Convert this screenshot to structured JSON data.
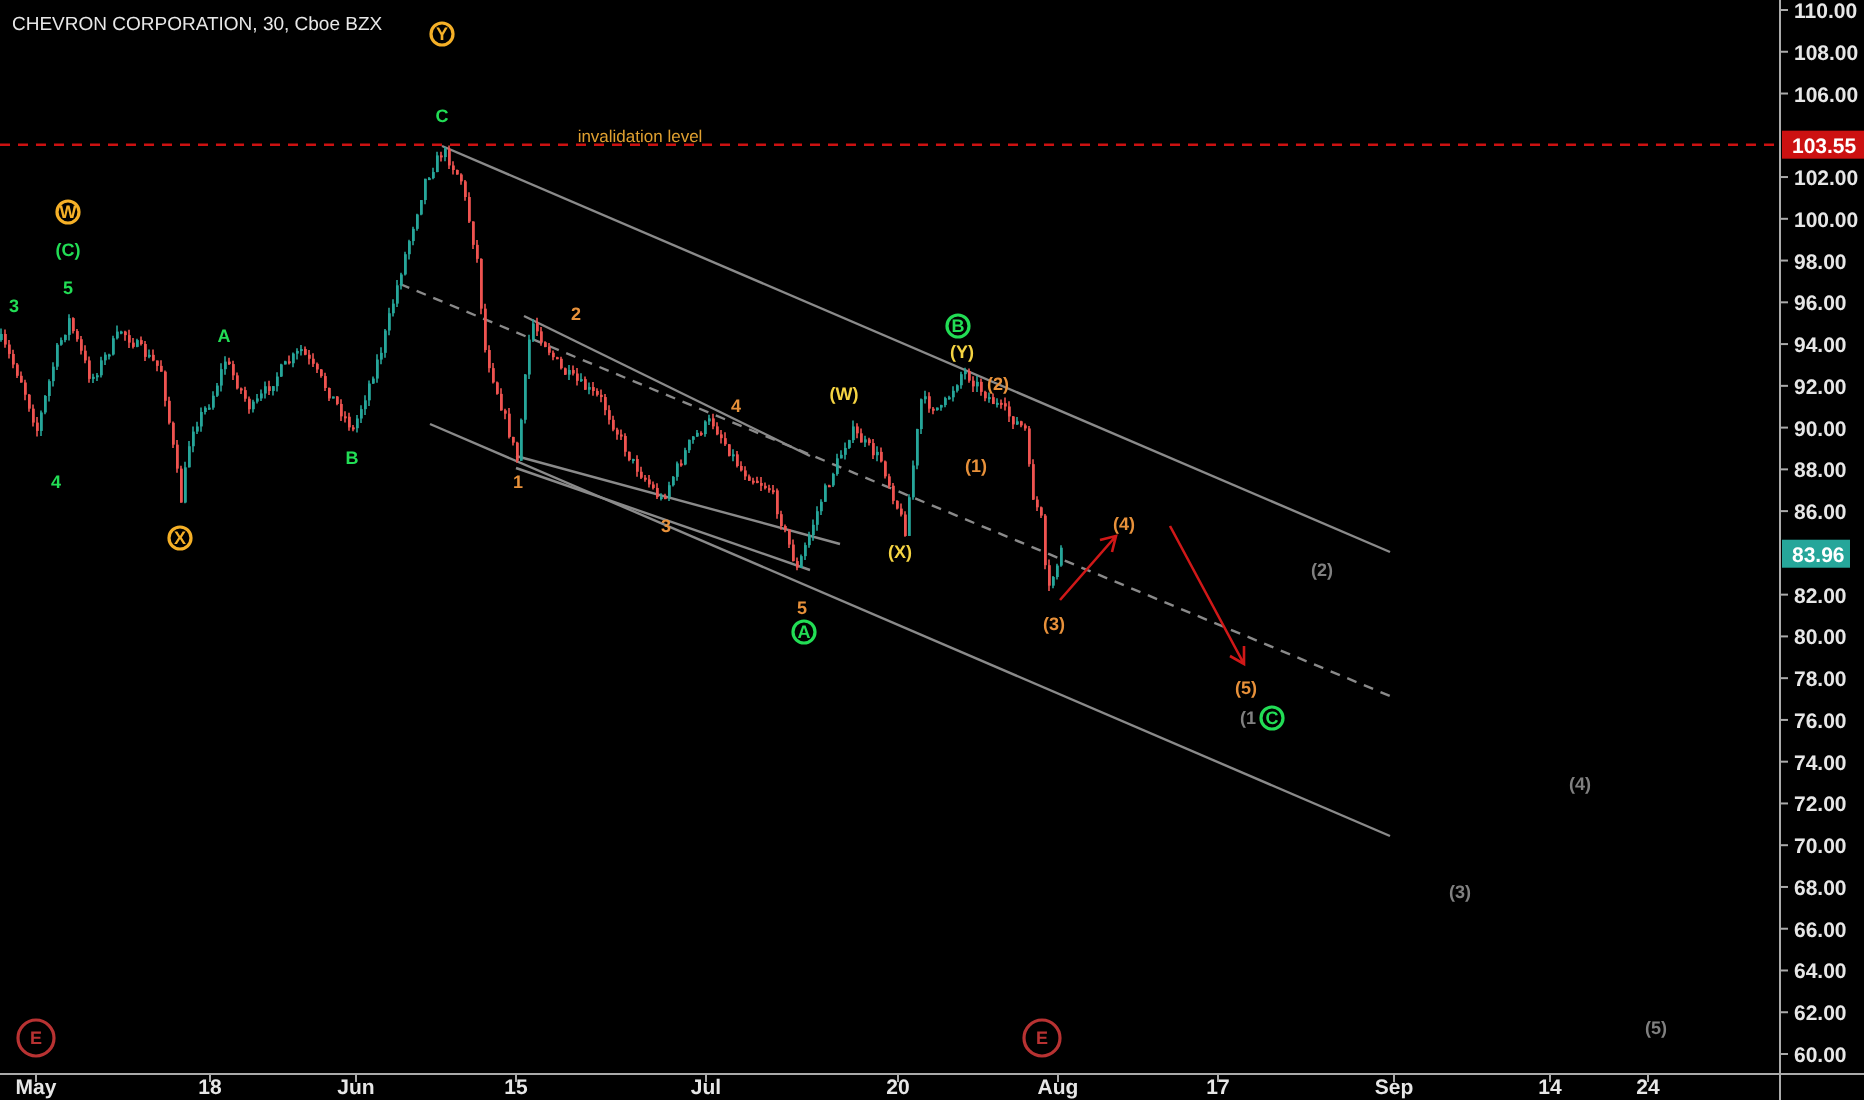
{
  "header": {
    "title": "CHEVRON CORPORATION, 30, Cboe BZX"
  },
  "price_axis": {
    "labels": [
      "110.00",
      "108.00",
      "106.00",
      "102.00",
      "100.00",
      "98.00",
      "96.00",
      "94.00",
      "92.00",
      "90.00",
      "88.00",
      "86.00",
      "82.00",
      "80.00",
      "78.00",
      "76.00",
      "74.00",
      "72.00",
      "70.00",
      "68.00",
      "66.00",
      "64.00",
      "62.00",
      "60.00"
    ],
    "markers": [
      {
        "kind": "line",
        "text": "103.55",
        "color": "#cc1111"
      },
      {
        "kind": "last",
        "text": "83.96",
        "color": "#26a69a"
      }
    ]
  },
  "time_axis": {
    "labels": [
      "May",
      "18",
      "Jun",
      "15",
      "Jul",
      "20",
      "Aug",
      "17",
      "Sep",
      "14",
      "24"
    ]
  },
  "drawings": {
    "line_label": "invalidation level",
    "wave_labels": [
      {
        "text": "Y",
        "kind": "circled",
        "color": "#f5b027"
      },
      {
        "text": "C",
        "kind": "plain",
        "color": "#22dd55"
      },
      {
        "text": "W",
        "kind": "circled",
        "color": "#f5b027"
      },
      {
        "text": "(C)",
        "kind": "plain",
        "color": "#22dd55"
      },
      {
        "text": "5",
        "kind": "plain",
        "color": "#22dd55"
      },
      {
        "text": "3",
        "kind": "plain",
        "color": "#22dd55"
      },
      {
        "text": "A",
        "kind": "plain",
        "color": "#22dd55"
      },
      {
        "text": "4",
        "kind": "plain",
        "color": "#22dd55"
      },
      {
        "text": "B",
        "kind": "plain",
        "color": "#22dd55"
      },
      {
        "text": "X",
        "kind": "circled",
        "color": "#f5b027"
      },
      {
        "text": "2",
        "kind": "plain",
        "color": "#e8913a"
      },
      {
        "text": "1",
        "kind": "plain",
        "color": "#e8913a"
      },
      {
        "text": "3",
        "kind": "plain",
        "color": "#e8913a"
      },
      {
        "text": "4",
        "kind": "plain",
        "color": "#e8913a"
      },
      {
        "text": "5",
        "kind": "plain",
        "color": "#e8913a"
      },
      {
        "text": "A",
        "kind": "circled",
        "color": "#22dd55"
      },
      {
        "text": "(W)",
        "kind": "plain",
        "color": "#f5d442"
      },
      {
        "text": "(X)",
        "kind": "plain",
        "color": "#f5d442"
      },
      {
        "text": "B",
        "kind": "circled",
        "color": "#22dd55"
      },
      {
        "text": "(Y)",
        "kind": "plain",
        "color": "#f5d442"
      },
      {
        "text": "(2)",
        "kind": "plain",
        "color": "#e8913a"
      },
      {
        "text": "(1)",
        "kind": "plain",
        "color": "#e8913a"
      },
      {
        "text": "(3)",
        "kind": "plain",
        "color": "#e8913a"
      },
      {
        "text": "(4)",
        "kind": "plain",
        "color": "#e8913a"
      },
      {
        "text": "(5)",
        "kind": "plain",
        "color": "#e8913a"
      },
      {
        "text": "(1",
        "kind": "plain",
        "color": "#808080"
      },
      {
        "text": "C",
        "kind": "circled",
        "color": "#22dd55"
      },
      {
        "text": "(2)",
        "kind": "plain",
        "color": "#808080"
      },
      {
        "text": "(3)",
        "kind": "plain",
        "color": "#808080"
      },
      {
        "text": "(4)",
        "kind": "plain",
        "color": "#808080"
      },
      {
        "text": "(5)",
        "kind": "plain",
        "color": "#808080"
      },
      {
        "text": "E",
        "kind": "event",
        "color": "#b83232"
      },
      {
        "text": "E",
        "kind": "event",
        "color": "#b83232"
      }
    ]
  }
}
